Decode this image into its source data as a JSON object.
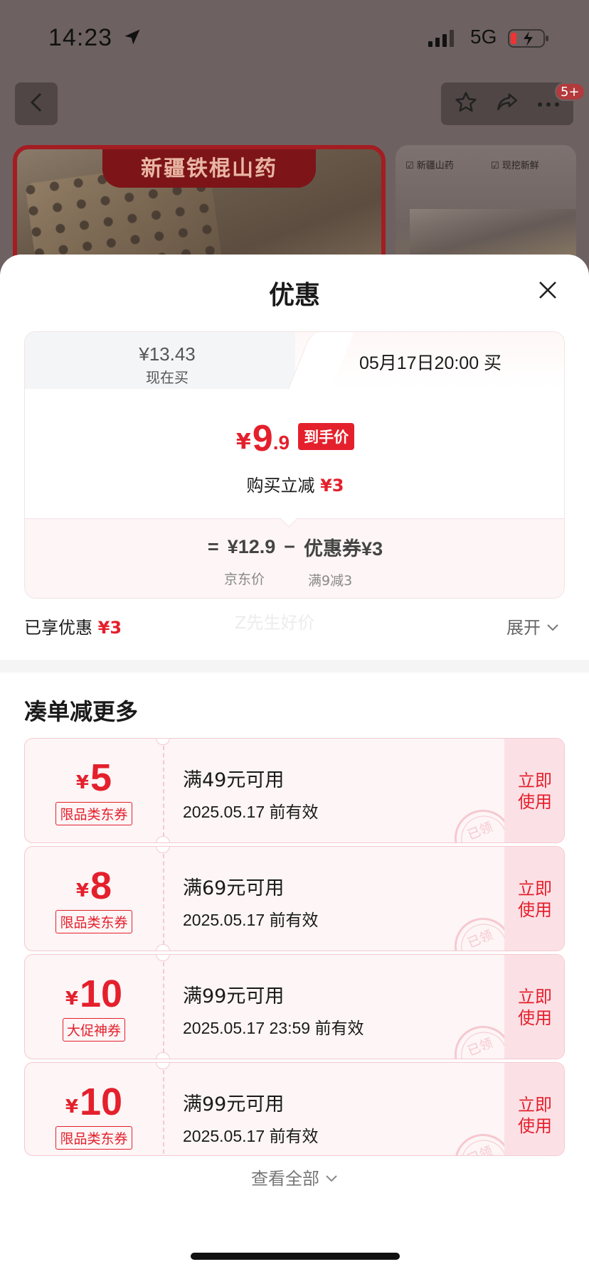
{
  "status_bar": {
    "time": "14:23",
    "network": "5G",
    "icons": [
      "location-arrow-icon",
      "signal-icon",
      "battery-charging-icon"
    ]
  },
  "background_page": {
    "nav_badge": "5+",
    "hero_title": "新疆铁棍山药",
    "side_features": [
      "新疆山药",
      "现挖新鲜"
    ],
    "icons": [
      "back-icon",
      "star-icon",
      "share-icon",
      "more-icon"
    ]
  },
  "sheet": {
    "title": "优惠",
    "close_icon": "close-icon"
  },
  "price_tabs": {
    "now": {
      "price": "¥13.43",
      "label": "现在买"
    },
    "later": {
      "label": "05月17日20:00 买"
    }
  },
  "final_price": {
    "currency": "¥",
    "integer": "9",
    "decimal": ".9",
    "tag": "到手价",
    "instant_prefix": "购买立减",
    "instant_amount": "¥3"
  },
  "formula": {
    "equals": "=",
    "jd_price": "¥12.9",
    "minus": "−",
    "coupon": "优惠券¥3",
    "jd_price_label": "京东价",
    "coupon_label": "满9减3"
  },
  "summary": {
    "enjoyed_label": "已享优惠",
    "enjoyed_amount": "¥3",
    "watermark": "Z先生好价",
    "expand_label": "展开"
  },
  "more_section": {
    "title": "凑单减更多",
    "coupons": [
      {
        "currency": "¥",
        "amount": "5",
        "kind": "限品类东券",
        "condition": "满49元可用",
        "validity": "2025.05.17 前有效",
        "action": "立即使用",
        "stamp": "已领"
      },
      {
        "currency": "¥",
        "amount": "8",
        "kind": "限品类东券",
        "condition": "满69元可用",
        "validity": "2025.05.17 前有效",
        "action": "立即使用",
        "stamp": "已领"
      },
      {
        "currency": "¥",
        "amount": "10",
        "kind": "大促神券",
        "condition": "满99元可用",
        "validity": "2025.05.17 23:59 前有效",
        "action": "立即使用",
        "stamp": "已领"
      },
      {
        "currency": "¥",
        "amount": "10",
        "kind": "限品类东券",
        "condition": "满99元可用",
        "validity": "2025.05.17 前有效",
        "action": "立即使用",
        "stamp": "已领"
      }
    ],
    "view_all": "查看全部"
  },
  "colors": {
    "accent_red": "#e4202c",
    "coupon_bg": "#fdf5f6",
    "overlay": "#6d6261"
  }
}
